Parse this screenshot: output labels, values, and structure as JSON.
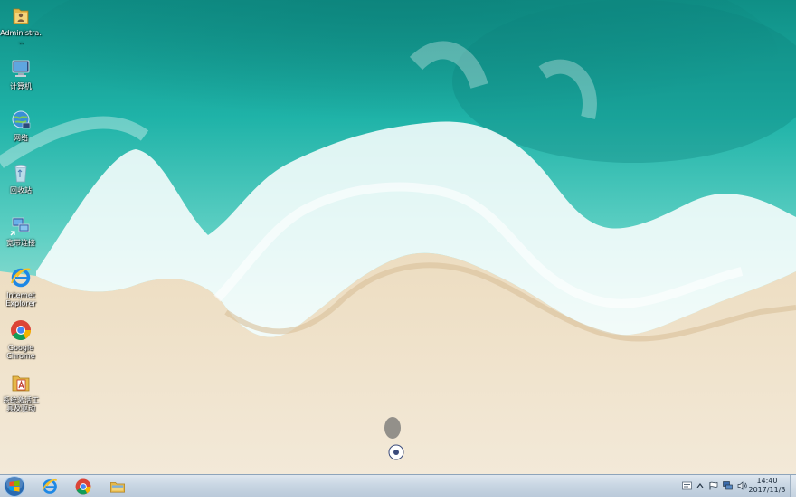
{
  "desktop": {
    "icons": [
      {
        "label": "Administra...",
        "icon": "user-folder-icon"
      },
      {
        "label": "计算机",
        "icon": "computer-icon"
      },
      {
        "label": "网络",
        "icon": "network-icon"
      },
      {
        "label": "回收站",
        "icon": "recycle-bin-icon"
      },
      {
        "label": "宽带连接",
        "icon": "broadband-connection-icon"
      },
      {
        "label": "Internet Explorer",
        "icon": "internet-explorer-icon"
      },
      {
        "label": "Google Chrome",
        "icon": "chrome-icon"
      },
      {
        "label": "系统激活工具及驱动",
        "icon": "activation-tool-icon"
      }
    ]
  },
  "taskbar": {
    "pinned": [
      {
        "name": "internet-explorer",
        "icon": "internet-explorer-icon"
      },
      {
        "name": "google-chrome",
        "icon": "chrome-icon"
      },
      {
        "name": "windows-explorer",
        "icon": "folder-icon"
      }
    ],
    "clock": {
      "time": "14:40",
      "date": "2017/11/3"
    }
  },
  "colors": {
    "ocean": "#1fb3a8",
    "sand": "#e9dcc3",
    "taskbar": "#c9d6e3"
  }
}
